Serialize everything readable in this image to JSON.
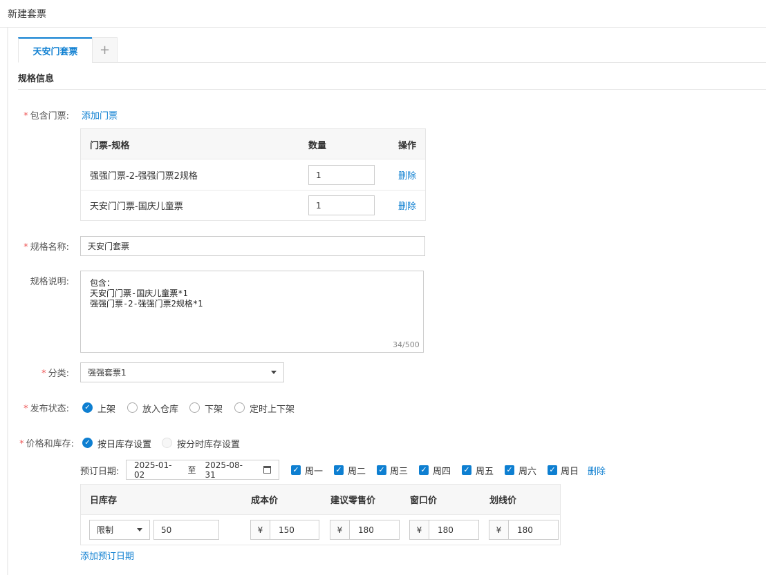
{
  "page": {
    "title": "新建套票"
  },
  "tabs": {
    "active_label": "天安门套票",
    "add_label": "+"
  },
  "section": {
    "title": "规格信息"
  },
  "tickets": {
    "label": "包含门票:",
    "add_link": "添加门票",
    "columns": [
      "门票-规格",
      "数量",
      "操作"
    ],
    "rows": [
      {
        "name": "强强门票-2-强强门票2规格",
        "qty": "1",
        "action": "删除"
      },
      {
        "name": "天安门门票-国庆儿童票",
        "qty": "1",
        "action": "删除"
      }
    ]
  },
  "spec_name": {
    "label": "规格名称:",
    "value": "天安门套票"
  },
  "spec_desc": {
    "label": "规格说明:",
    "value": "包含：\n天安门门票-国庆儿童票*1\n强强门票-2-强强门票2规格*1",
    "counter": "34/500"
  },
  "category": {
    "label": "分类:",
    "value": "强强套票1"
  },
  "publish": {
    "label": "发布状态:",
    "options": [
      "上架",
      "放入仓库",
      "下架",
      "定时上下架"
    ],
    "selected": "上架"
  },
  "price_stock": {
    "label": "价格和库存:",
    "options": [
      "按日库存设置",
      "按分时库存设置"
    ],
    "selected": "按日库存设置"
  },
  "booking": {
    "label": "预订日期:",
    "start": "2025-01-02",
    "separator": "至",
    "end": "2025-08-31",
    "weekdays": [
      "周一",
      "周二",
      "周三",
      "周四",
      "周五",
      "周六",
      "周日"
    ],
    "delete_label": "删除"
  },
  "stock_table": {
    "columns": [
      "日库存",
      "成本价",
      "建议零售价",
      "窗口价",
      "划线价"
    ],
    "stock_mode": "限制",
    "stock_value": "50",
    "currency": "¥",
    "prices": [
      "150",
      "180",
      "180",
      "180"
    ]
  },
  "add_date_link": "添加预订日期",
  "colors": {
    "accent": "#0e7fd1",
    "required": "#e55555"
  },
  "icons": {
    "calendar": "calendar-icon",
    "dropdown": "caret-down-icon",
    "check": "check-icon"
  }
}
